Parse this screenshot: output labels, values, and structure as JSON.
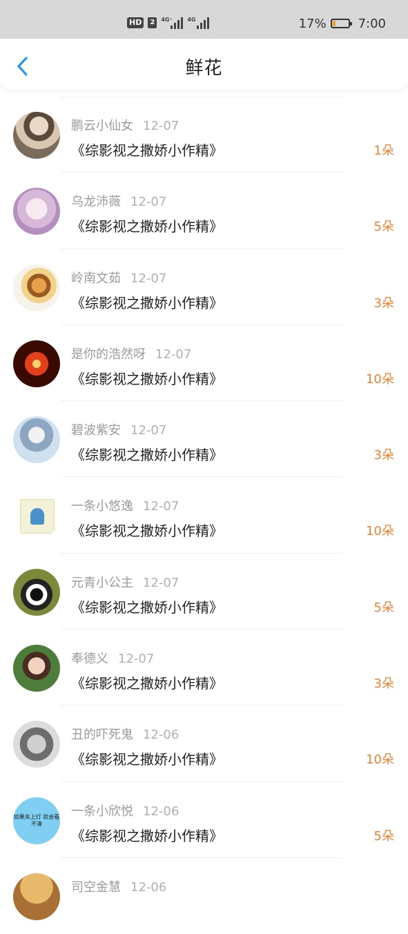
{
  "status_bar": {
    "hd": "HD",
    "sim_number": "2",
    "network_1": "4G⁺",
    "network_2": "4G",
    "battery_percent": "17%",
    "battery_level": 0.17,
    "time": "7:00"
  },
  "nav": {
    "title": "鲜花",
    "back_icon": "chevron-left-icon",
    "accent_color": "#2196f3"
  },
  "colors": {
    "count": "#f07f2e",
    "name": "#9a9a9a"
  },
  "items": [
    {
      "name": "鹏云小仙女",
      "date": "12-07",
      "book": "《综影视之撒娇小作精》",
      "count": "1朵"
    },
    {
      "name": "乌龙沛薇",
      "date": "12-07",
      "book": "《综影视之撒娇小作精》",
      "count": "5朵"
    },
    {
      "name": "岭南文茹",
      "date": "12-07",
      "book": "《综影视之撒娇小作精》",
      "count": "3朵"
    },
    {
      "name": "是你的浩然呀",
      "date": "12-07",
      "book": "《综影视之撒娇小作精》",
      "count": "10朵"
    },
    {
      "name": "碧波紫安",
      "date": "12-07",
      "book": "《综影视之撒娇小作精》",
      "count": "3朵"
    },
    {
      "name": "一条小悠逸",
      "date": "12-07",
      "book": "《综影视之撒娇小作精》",
      "count": "10朵"
    },
    {
      "name": "元青小公主",
      "date": "12-07",
      "book": "《综影视之撒娇小作精》",
      "count": "5朵"
    },
    {
      "name": "奉德义",
      "date": "12-07",
      "book": "《综影视之撒娇小作精》",
      "count": "3朵"
    },
    {
      "name": "丑的吓死鬼",
      "date": "12-06",
      "book": "《综影视之撒娇小作精》",
      "count": "10朵"
    },
    {
      "name": "一条小欣悦",
      "date": "12-06",
      "book": "《综影视之撒娇小作精》",
      "count": "5朵"
    },
    {
      "name": "司空金慧",
      "date": "12-06",
      "book": "",
      "count": ""
    }
  ],
  "avatar_10_text": "如果关上灯 就会看不清"
}
